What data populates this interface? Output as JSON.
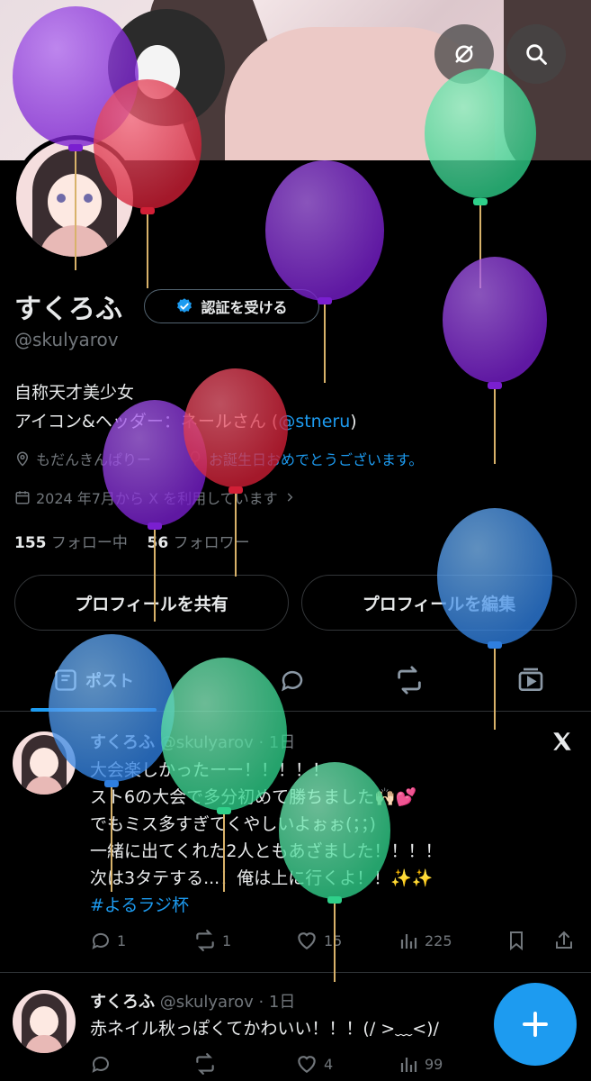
{
  "colors": {
    "accent": "#1d9bf0",
    "text_primary": "#e7e9ea",
    "text_secondary": "#71767b",
    "background": "#000000",
    "balloon_purple": "#8a2be2",
    "balloon_red": "#e0303f",
    "balloon_green": "#3ddc97",
    "balloon_blue": "#3a8ee6"
  },
  "header": {
    "link_icon": "link-off-icon",
    "search_icon": "search-icon"
  },
  "profile": {
    "display_name": "すくろふ",
    "verify_label": "認証を受ける",
    "handle": "@skulyarov",
    "bio_line1": "自称天才美少女",
    "bio_line2_text": "アイコン&ヘッダー：ネールさん (",
    "bio_line2_mention": "@stneru",
    "bio_line2_close": ")",
    "location": "もだんきんぱりー",
    "birthday_link": "お誕生日おめでとうございます。",
    "joined": "2024 年7月から X を利用しています",
    "following_count": "155",
    "following_label": "フォロー中",
    "followers_count": "56",
    "followers_label": "フォロワー"
  },
  "buttons": {
    "share_profile": "プロフィールを共有",
    "edit_profile": "プロフィールを編集"
  },
  "tabs": {
    "posts_label": "ポスト"
  },
  "posts": [
    {
      "name": "すくろふ",
      "handle_time": "@skulyarov · 1日",
      "line1": "大会楽しかったーー！！！！！",
      "line2": "スト6の大会で多分初めて勝ちました🙌🏻💕",
      "line3": "でもミス多すぎてくやしいよぉぉ(；；)",
      "line4": "一緒に出てくれた2人ともあざました！！！！",
      "line5": "次は3タテする...！俺は上に行くよ！！✨✨",
      "hashtag": "#よるラジ杯",
      "replies": "1",
      "reposts": "1",
      "likes": "15",
      "views": "225"
    },
    {
      "name": "すくろふ",
      "handle_time": "@skulyarov · 1日",
      "line1": "赤ネイル秋っぽくてかわいい！！！(/ >﹏<)/",
      "replies": "",
      "reposts": "",
      "likes": "4",
      "views": "99"
    }
  ]
}
